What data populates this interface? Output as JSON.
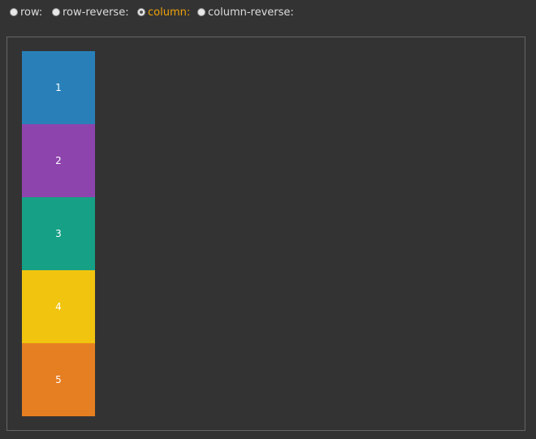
{
  "options": [
    {
      "label": "row:",
      "checked": false
    },
    {
      "label": "row-reverse:",
      "checked": false
    },
    {
      "label": "column:",
      "checked": true
    },
    {
      "label": "column-reverse:",
      "checked": false
    }
  ],
  "colors": {
    "selected_label": "#f0a30a",
    "background": "#333333"
  },
  "items": [
    {
      "label": "1",
      "color": "#2980b9"
    },
    {
      "label": "2",
      "color": "#8e44ad"
    },
    {
      "label": "3",
      "color": "#16a085"
    },
    {
      "label": "4",
      "color": "#f1c40f"
    },
    {
      "label": "5",
      "color": "#e67e22"
    }
  ]
}
